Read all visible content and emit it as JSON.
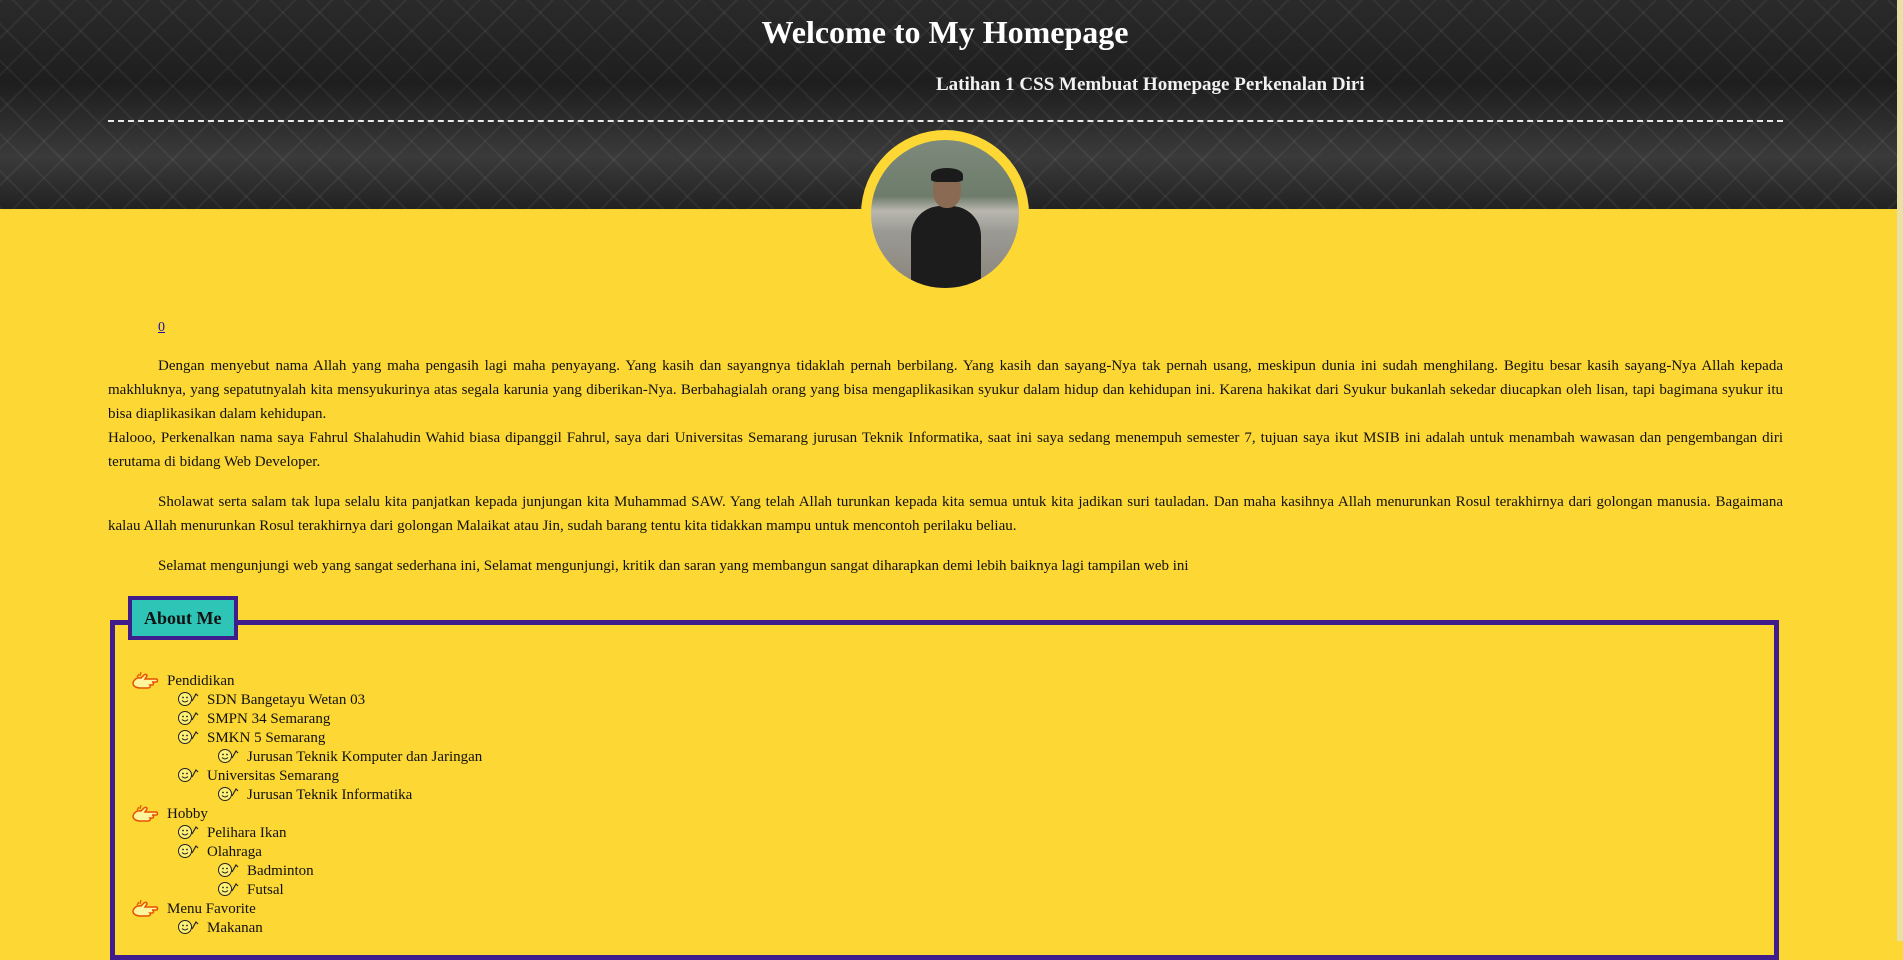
{
  "header": {
    "title": "Welcome to My Homepage",
    "subtitle": "Latihan 1 CSS Membuat Homepage Perkenalan Diri"
  },
  "anchor_text": "0",
  "paragraphs": [
    "Dengan menyebut nama Allah yang maha pengasih lagi maha penyayang. Yang kasih dan sayangnya tidaklah pernah berbilang. Yang kasih dan sayang-Nya tak pernah usang, meskipun dunia ini sudah menghilang. Begitu besar kasih sayang-Nya Allah kepada makhluknya, yang sepatutnyalah kita mensyukurinya atas segala karunia yang diberikan-Nya. Berbahagialah orang yang bisa mengaplikasikan syukur dalam hidup dan kehidupan ini. Karena hakikat dari Syukur bukanlah sekedar diucapkan oleh lisan, tapi bagimana syukur itu bisa diaplikasikan dalam kehidupan.",
    "Halooo, Perkenalkan nama saya Fahrul Shalahudin Wahid biasa dipanggil Fahrul, saya dari Universitas Semarang jurusan Teknik Informatika, saat ini saya sedang menempuh semester 7, tujuan saya ikut MSIB ini adalah untuk menambah wawasan dan pengembangan diri terutama di bidang Web Developer.",
    "Sholawat serta salam tak lupa selalu kita panjatkan kepada junjungan kita Muhammad SAW. Yang telah Allah turunkan kepada kita semua untuk kita jadikan suri tauladan. Dan maha kasihnya Allah menurunkan Rosul terakhirnya dari golongan manusia. Bagaimana kalau Allah menurunkan Rosul terakhirnya dari golongan Malaikat atau Jin, sudah barang tentu kita tidakkan mampu untuk mencontoh perilaku beliau.",
    "Selamat mengunjungi web yang sangat sederhana ini, Selamat mengunjungi, kritik dan saran yang membangun sangat diharapkan demi lebih baiknya lagi tampilan web ini"
  ],
  "about": {
    "legend": "About Me",
    "items": [
      {
        "label": "Pendidikan",
        "level": 0
      },
      {
        "label": "SDN Bangetayu Wetan 03",
        "level": 1
      },
      {
        "label": "SMPN 34 Semarang",
        "level": 1
      },
      {
        "label": "SMKN 5 Semarang",
        "level": 1
      },
      {
        "label": "Jurusan Teknik Komputer dan Jaringan",
        "level": 2
      },
      {
        "label": "Universitas Semarang",
        "level": 1
      },
      {
        "label": "Jurusan Teknik Informatika",
        "level": 2
      },
      {
        "label": "Hobby",
        "level": 0
      },
      {
        "label": "Pelihara Ikan",
        "level": 1
      },
      {
        "label": "Olahraga",
        "level": 1
      },
      {
        "label": "Badminton",
        "level": 2
      },
      {
        "label": "Futsal",
        "level": 2
      },
      {
        "label": "Menu Favorite",
        "level": 0
      },
      {
        "label": "Makanan",
        "level": 1
      }
    ]
  },
  "colors": {
    "page_background": "#fdd835",
    "fieldset_border": "#3f1d8c",
    "legend_background": "#2ec4b6"
  },
  "icons": {
    "level0": "pointing-hand-icon",
    "level1": "smiley-icon",
    "level2": "smiley-icon"
  }
}
